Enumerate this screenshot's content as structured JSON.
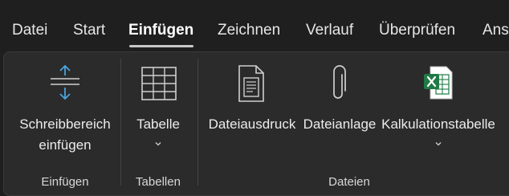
{
  "tabs": {
    "datei": "Datei",
    "start": "Start",
    "einfuegen": "Einfügen",
    "zeichnen": "Zeichnen",
    "verlauf": "Verlauf",
    "ueberpruefen": "Überprüfen",
    "ansicht_partial": "Ans"
  },
  "active_tab": "Einfügen",
  "ribbon": {
    "einfuegen_group": {
      "label": "Einfügen",
      "schreibbereich": {
        "line1": "Schreibbereich",
        "line2": "einfügen",
        "icon": "insert-space-icon"
      }
    },
    "tabellen_group": {
      "label": "Tabellen",
      "tabelle": {
        "label": "Tabelle",
        "icon": "table-icon"
      }
    },
    "dateien_group": {
      "label": "Dateien",
      "dateiausdruck": {
        "label": "Dateiausdruck",
        "icon": "file-printout-icon"
      },
      "dateianlage": {
        "label": "Dateianlage",
        "icon": "paperclip-icon"
      },
      "kalkulationstabelle": {
        "label": "Kalkulationstabelle",
        "icon": "excel-icon"
      }
    }
  },
  "colors": {
    "accent_blue": "#4aa3df",
    "excel_green": "#1f7a45",
    "background": "#1f1f1f",
    "ribbon": "#2b2b2b"
  }
}
